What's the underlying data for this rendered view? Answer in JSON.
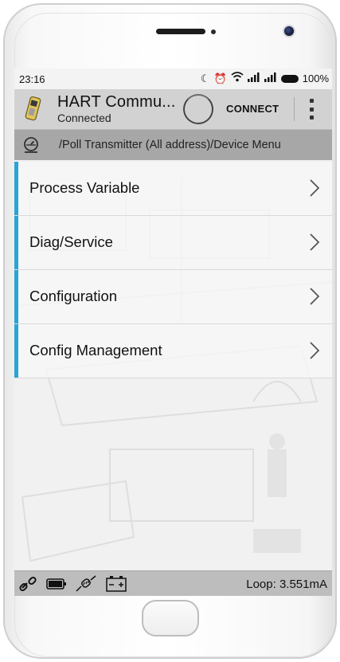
{
  "statusbar": {
    "time": "23:16",
    "battery_percent": "100%",
    "icons": [
      "moon-icon",
      "alarm-icon",
      "wifi-icon",
      "signal-icon",
      "signal-icon-2",
      "battery-icon"
    ]
  },
  "appbar": {
    "title": "HART Commu...",
    "subtitle": "Connected",
    "connect_label": "CONNECT",
    "logo_icon": "hart-communicator-icon",
    "overflow_icon": "more-vert-icon"
  },
  "breadcrumb": {
    "icon": "gauge-icon",
    "path": "/Poll Transmitter (All address)/Device Menu"
  },
  "menu": {
    "items": [
      {
        "label": "Process Variable"
      },
      {
        "label": "Diag/Service"
      },
      {
        "label": "Configuration"
      },
      {
        "label": "Config Management"
      }
    ],
    "accent_color": "#2aa4d6"
  },
  "bottombar": {
    "icons": [
      "link-icon",
      "battery-icon",
      "resistor-icon",
      "power-supply-icon"
    ],
    "loop_text": "Loop: 3.551mA"
  }
}
